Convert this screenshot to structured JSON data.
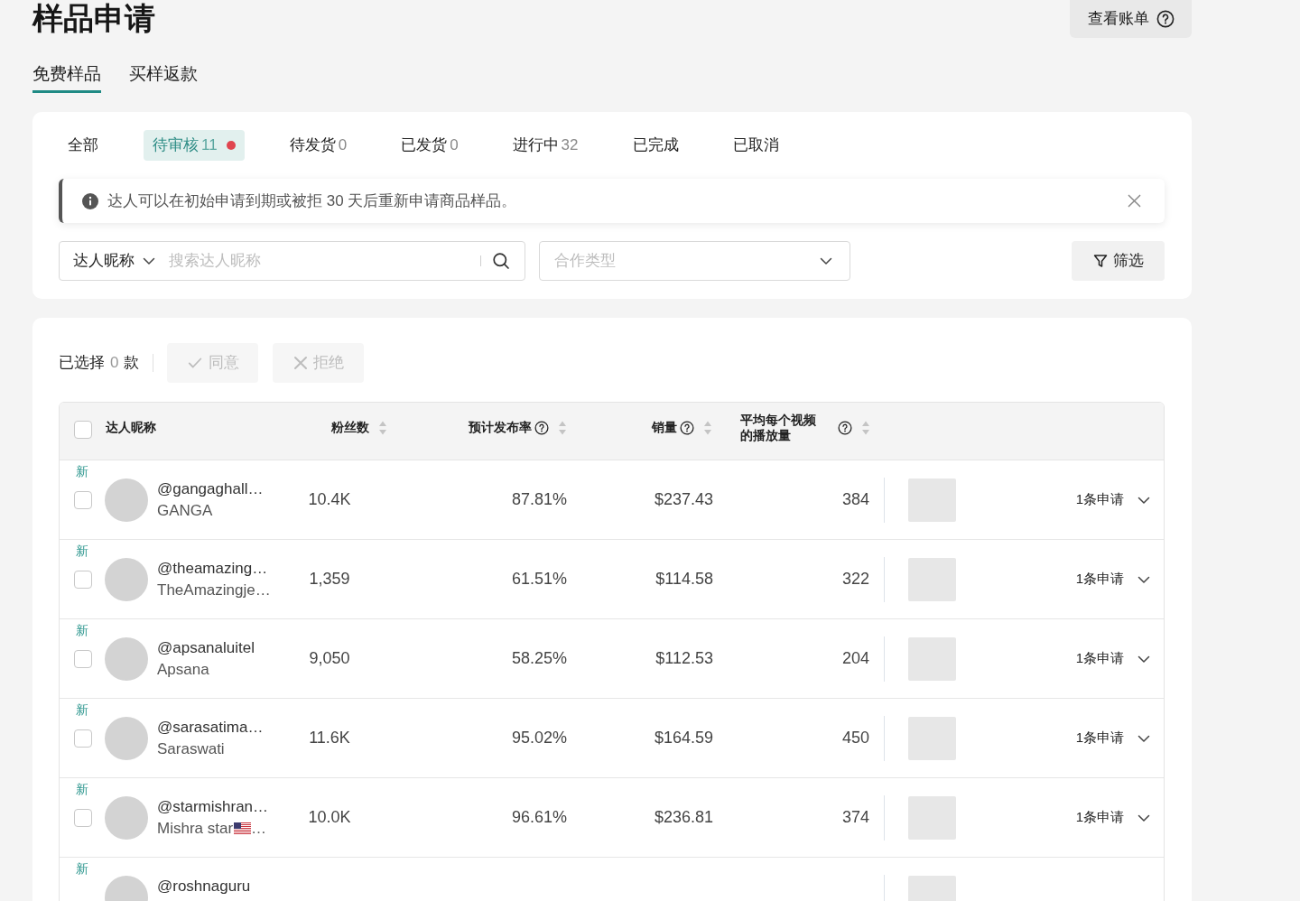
{
  "header": {
    "title": "样品申请",
    "bill_button": "查看账单"
  },
  "main_tabs": [
    {
      "label": "免费样品",
      "selected": true
    },
    {
      "label": "买样返款",
      "selected": false
    }
  ],
  "status_tabs": [
    {
      "label": "全部",
      "selected": false,
      "unread": false
    },
    {
      "label": "待审核",
      "count": "11",
      "selected": true,
      "unread": true
    },
    {
      "label": "待发货",
      "count": "0",
      "selected": false,
      "unread": false
    },
    {
      "label": "已发货",
      "count": "0",
      "selected": false,
      "unread": false
    },
    {
      "label": "进行中",
      "count": "32",
      "selected": false,
      "unread": false
    },
    {
      "label": "已完成",
      "selected": false,
      "unread": false
    },
    {
      "label": "已取消",
      "selected": false,
      "unread": false
    }
  ],
  "notice": {
    "text": "达人可以在初始申请到期或被拒 30 天后重新申请商品样品。"
  },
  "search": {
    "scope": "达人昵称",
    "placeholder": "搜索达人昵称"
  },
  "type_select": {
    "placeholder": "合作类型"
  },
  "filter_button": "筛选",
  "selection": {
    "prefix": "已选择",
    "count": "0",
    "suffix": "款",
    "buttons": [
      {
        "kind": "approve",
        "label": "同意",
        "disabled": true
      },
      {
        "kind": "reject",
        "label": "拒绝",
        "disabled": true
      }
    ]
  },
  "table": {
    "select_all_checked": false,
    "columns": [
      {
        "label": "达人昵称",
        "help": false,
        "sortable": false
      },
      {
        "label": "粉丝数",
        "help": false,
        "sortable": true
      },
      {
        "label": "预计发布率",
        "help": true,
        "sortable": true
      },
      {
        "label": "销量",
        "help": true,
        "sortable": true
      },
      {
        "label": "平均每个视频的播放量",
        "help": true,
        "sortable": true
      }
    ],
    "rows": [
      {
        "new_label": "新",
        "checked": false,
        "handle": "@gangaghall…",
        "name": "GANGA",
        "flag": false,
        "followers": "10.4K",
        "post_rate": "87.81%",
        "sales": "$237.43",
        "avg_views": "384",
        "requests": "1条申请"
      },
      {
        "new_label": "新",
        "checked": false,
        "handle": "@theamazing…",
        "name": "TheAmazingje…",
        "flag": false,
        "followers": "1,359",
        "post_rate": "61.51%",
        "sales": "$114.58",
        "avg_views": "322",
        "requests": "1条申请"
      },
      {
        "new_label": "新",
        "checked": false,
        "handle": "@apsanaluitel",
        "name": "Apsana",
        "flag": false,
        "followers": "9,050",
        "post_rate": "58.25%",
        "sales": "$112.53",
        "avg_views": "204",
        "requests": "1条申请"
      },
      {
        "new_label": "新",
        "checked": false,
        "handle": "@sarasatima…",
        "name": "Saraswati",
        "flag": false,
        "followers": "11.6K",
        "post_rate": "95.02%",
        "sales": "$164.59",
        "avg_views": "450",
        "requests": "1条申请"
      },
      {
        "new_label": "新",
        "checked": false,
        "handle": "@starmishran…",
        "name": "Mishra star",
        "flag": true,
        "name_end": "…",
        "followers": "10.0K",
        "post_rate": "96.61%",
        "sales": "$236.81",
        "avg_views": "374",
        "requests": "1条申请"
      },
      {
        "new_label": "新",
        "handle": "@roshnaguru"
      }
    ]
  }
}
